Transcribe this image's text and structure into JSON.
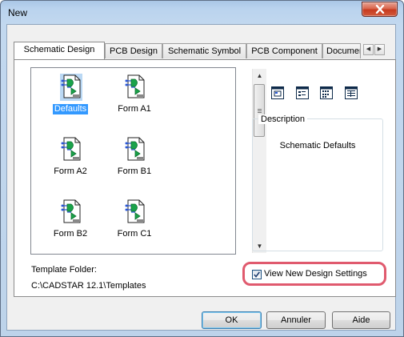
{
  "window": {
    "title": "New"
  },
  "tabs": [
    {
      "label": "Schematic Design",
      "active": true
    },
    {
      "label": "PCB Design"
    },
    {
      "label": "Schematic Symbol"
    },
    {
      "label": "PCB Component"
    },
    {
      "label": "Documen"
    }
  ],
  "templates": [
    {
      "label": "Defaults",
      "selected": true,
      "icon": "schematic-template-icon"
    },
    {
      "label": "Form A1",
      "icon": "schematic-template-icon"
    },
    {
      "label": "Form A2",
      "icon": "schematic-template-icon"
    },
    {
      "label": "Form B1",
      "icon": "schematic-template-icon"
    },
    {
      "label": "Form B2",
      "icon": "schematic-template-icon"
    },
    {
      "label": "Form C1",
      "icon": "schematic-template-icon"
    }
  ],
  "view_buttons": [
    "large-icons-view-icon",
    "small-icons-view-icon",
    "list-view-icon",
    "details-view-icon"
  ],
  "description": {
    "title": "Description",
    "text": "Schematic Defaults"
  },
  "template_folder": {
    "label": "Template Folder:",
    "path": "C:\\CADSTAR 12.1\\Templates"
  },
  "view_settings": {
    "label": "View New Design Settings",
    "checked": true
  },
  "buttons": {
    "ok": "OK",
    "cancel": "Annuler",
    "help": "Aide"
  },
  "colors": {
    "selection": "#3399ff",
    "highlight": "#e05a6e",
    "close_button": "#c63a1f"
  }
}
